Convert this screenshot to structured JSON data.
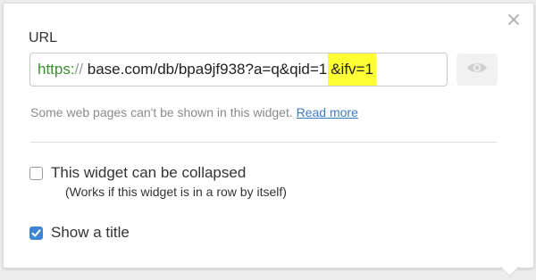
{
  "url_field": {
    "label": "URL",
    "protocol": "https:",
    "slashes": "//",
    "body": " base.com/db/bpa9jf938?a=q&qid=1",
    "highlight": "&ifv=1"
  },
  "preview_button": {
    "icon": "eye-icon"
  },
  "close_button": {
    "icon": "close-icon"
  },
  "note": {
    "text": "Some web pages can't be shown in this widget.",
    "link": "Read more"
  },
  "options": {
    "collapsible": {
      "label": "This widget can be collapsed",
      "hint": "(Works if this widget is in a row by itself)",
      "checked": false
    },
    "show_title": {
      "label": "Show a title",
      "checked": true
    }
  },
  "colors": {
    "protocol": "#3b8f2e",
    "highlight": "#ffff33",
    "link": "#3a7bc8",
    "checkbox_checked": "#3f85d6"
  }
}
